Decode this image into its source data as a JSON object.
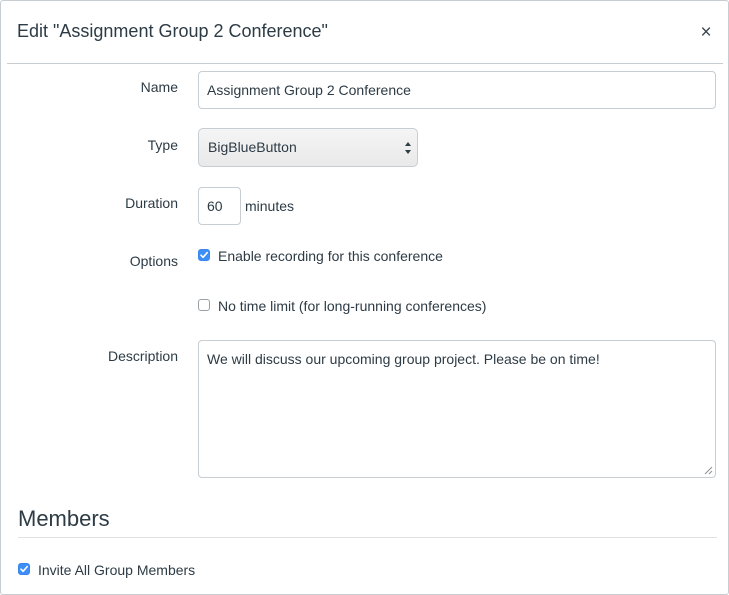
{
  "dialog": {
    "title": "Edit \"Assignment Group 2 Conference\"",
    "close_label": "×"
  },
  "form": {
    "name": {
      "label": "Name",
      "value": "Assignment Group 2 Conference"
    },
    "type": {
      "label": "Type",
      "selected": "BigBlueButton"
    },
    "duration": {
      "label": "Duration",
      "value": "60",
      "unit": "minutes"
    },
    "options": {
      "label": "Options",
      "enable_recording": {
        "label": "Enable recording for this conference",
        "checked": true
      },
      "no_time_limit": {
        "label": "No time limit (for long-running conferences)",
        "checked": false
      }
    },
    "description": {
      "label": "Description",
      "value": "We will discuss our upcoming group project. Please be on time!"
    }
  },
  "members": {
    "heading": "Members",
    "invite_all": {
      "label": "Invite All Group Members",
      "checked": true
    }
  },
  "colors": {
    "checkbox_checked": "#3e8ef7",
    "text": "#2d3b45",
    "border": "#c7cdd1"
  }
}
